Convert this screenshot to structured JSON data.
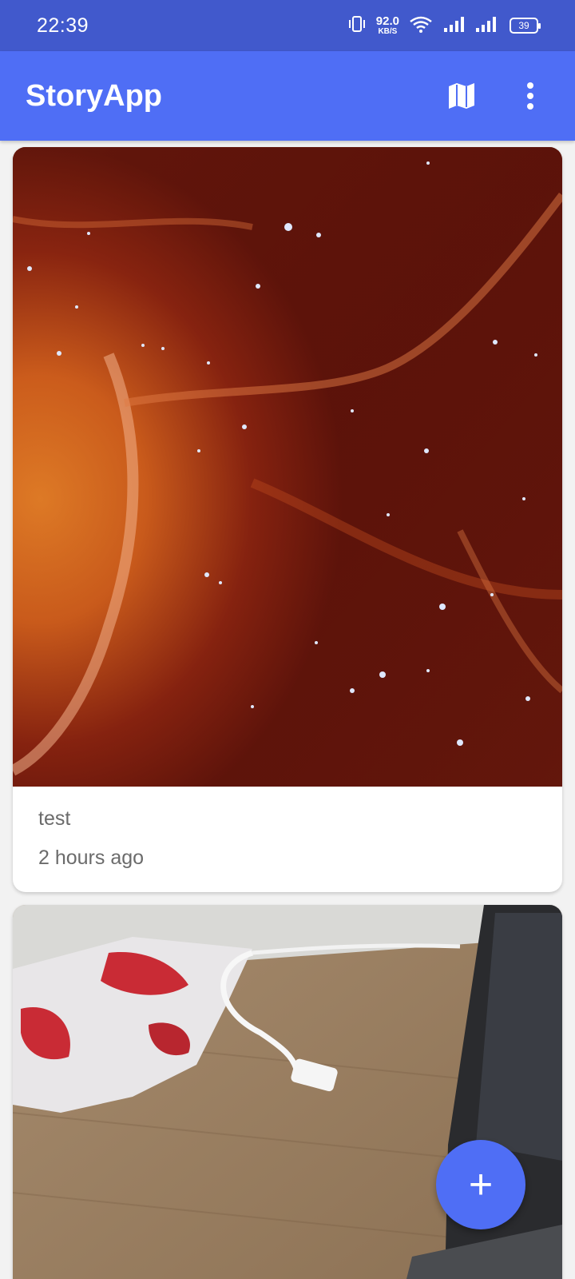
{
  "status_bar": {
    "time": "22:39",
    "net_speed": "92.0",
    "net_unit": "KB/S",
    "battery": "39"
  },
  "app_bar": {
    "title": "StoryApp",
    "map_icon": "map-icon",
    "menu_icon": "more-vert-icon"
  },
  "stories": [
    {
      "name": "test",
      "date": "2 hours ago",
      "image": "nebula-photo"
    },
    {
      "image": "desk-photo"
    }
  ],
  "fab": {
    "label": "+",
    "icon": "add-icon"
  },
  "colors": {
    "status_bar": "#4159cc",
    "app_bar": "#4f6ef5",
    "fab": "#4f6ef5"
  }
}
